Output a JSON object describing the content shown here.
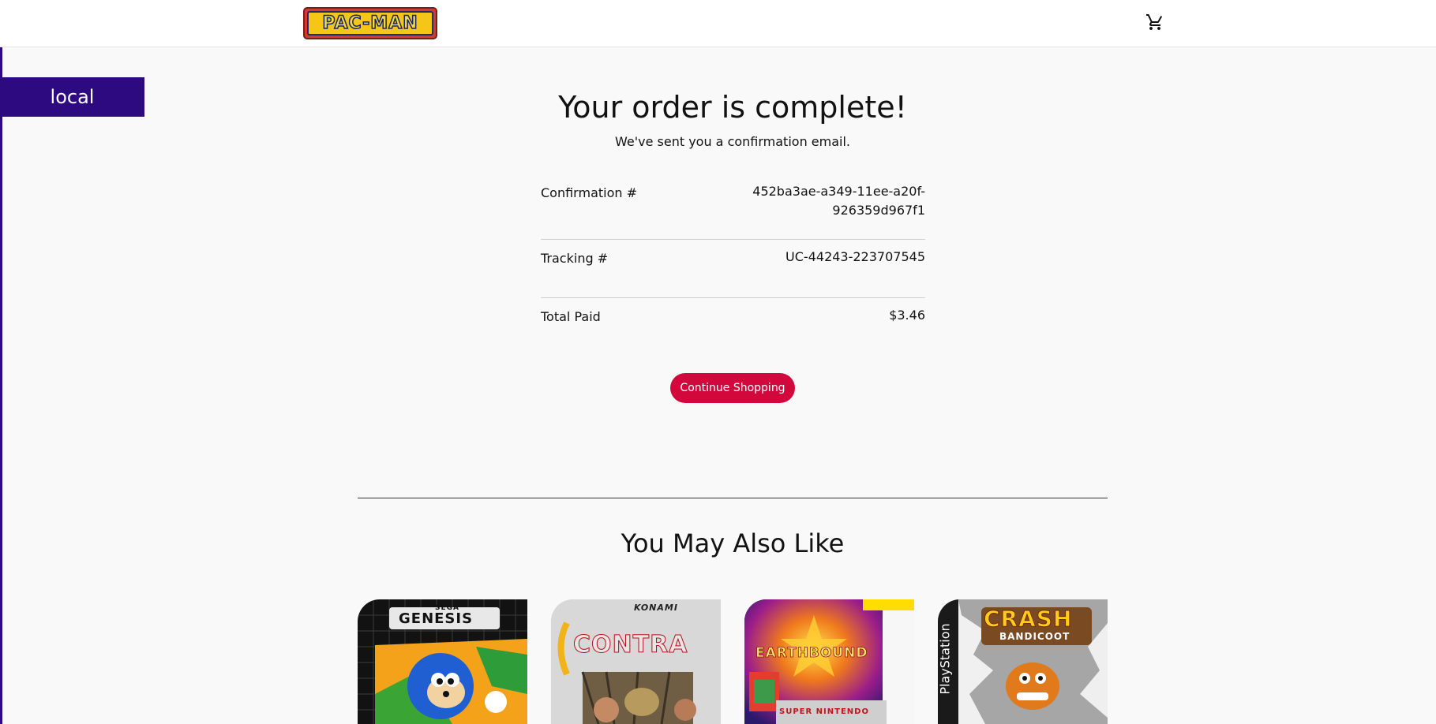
{
  "brand": {
    "logo_text": "PAC-MAN"
  },
  "header": {
    "cart_icon": "shopping-cart-icon"
  },
  "env_badge": "local",
  "order": {
    "title": "Your order is complete!",
    "subtitle": "We've sent you a confirmation email.",
    "confirmation_label": "Confirmation #",
    "confirmation_value_line1": "452ba3ae-a349-11ee-a20f-",
    "confirmation_value_line2": "926359d967f1",
    "tracking_label": "Tracking #",
    "tracking_value": "UC-44243-223707545",
    "total_label": "Total Paid",
    "total_value": "$3.46",
    "continue_label": "Continue Shopping"
  },
  "recommendations": {
    "title": "You May Also Like",
    "items": [
      {
        "name": "Sonic the Hedgehog",
        "cover_text_1": "SEGA",
        "cover_text_2": "GENESIS"
      },
      {
        "name": "Contra",
        "cover_text_1": "KONAMI",
        "cover_text_2": "CONTRA"
      },
      {
        "name": "EarthBound",
        "cover_text_1": "EARTHBOUND",
        "cover_text_2": "SUPER NINTENDO"
      },
      {
        "name": "Crash Bandicoot",
        "cover_text_1": "CRASH",
        "cover_text_2": "BANDICOOT",
        "cover_text_3": "PlayStation"
      }
    ]
  },
  "colors": {
    "accent": "#d2083c",
    "badge": "#2e0a80",
    "background": "#f9f9f9"
  }
}
